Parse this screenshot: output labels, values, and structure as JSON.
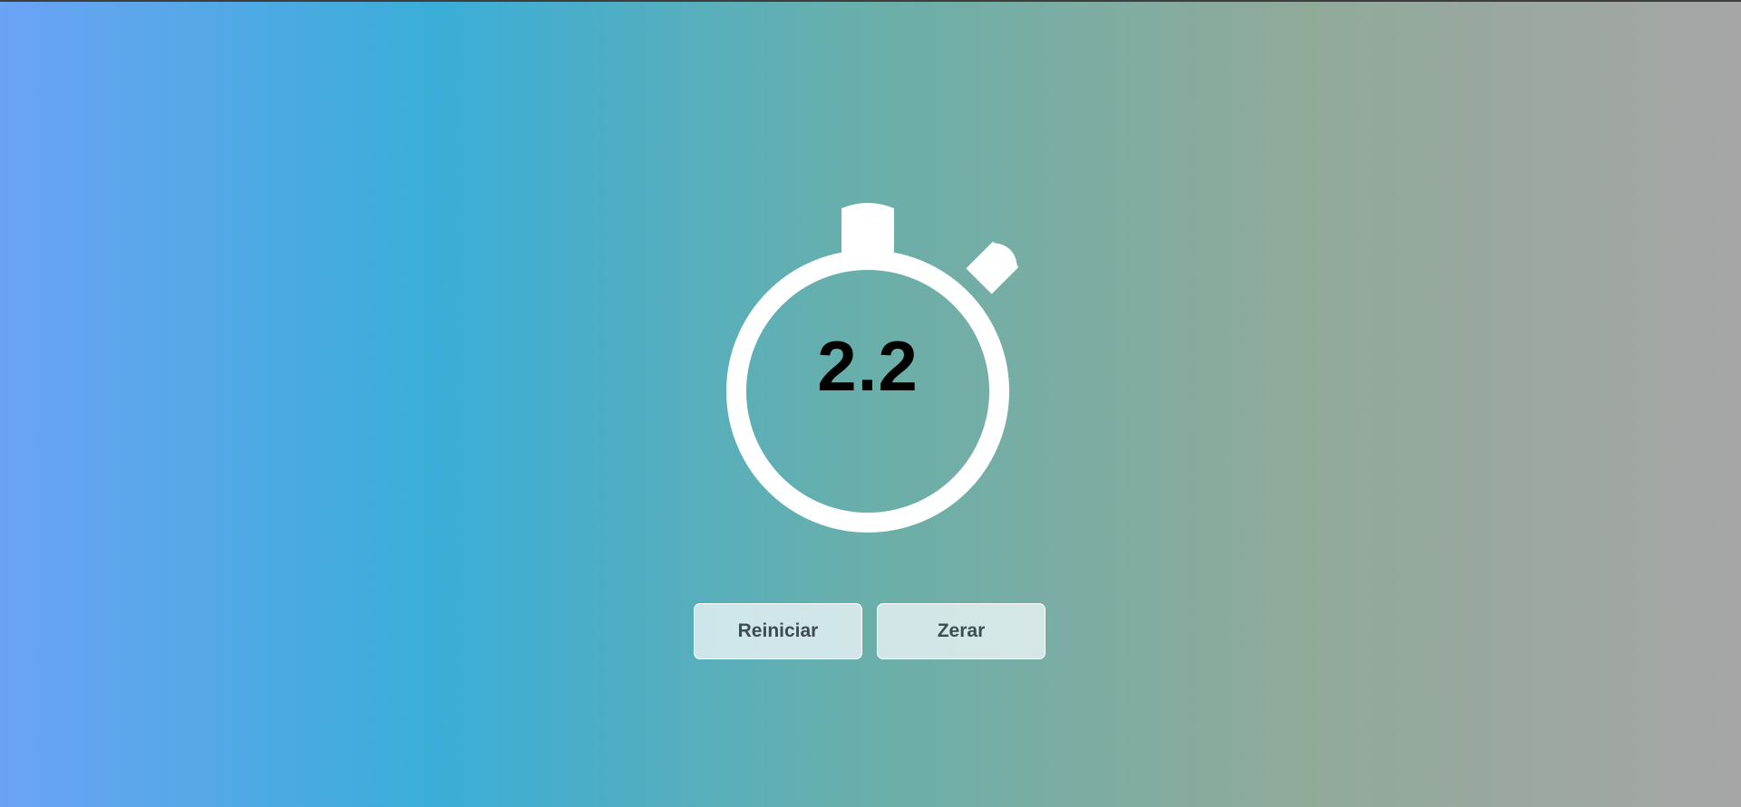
{
  "stopwatch": {
    "time": "2.2"
  },
  "controls": {
    "restart_label": "Reiniciar",
    "reset_label": "Zerar"
  },
  "colors": {
    "gradient": [
      "#6ba3f5",
      "#3aaed8",
      "#6aafaa",
      "#90aa9a",
      "#a6a6a6"
    ],
    "ring": "#ffffff",
    "time_text": "#000000",
    "button_bg": "#e6f0f2",
    "button_text": "#3d4c52"
  },
  "icons": {
    "stopwatch": "stopwatch-icon"
  }
}
